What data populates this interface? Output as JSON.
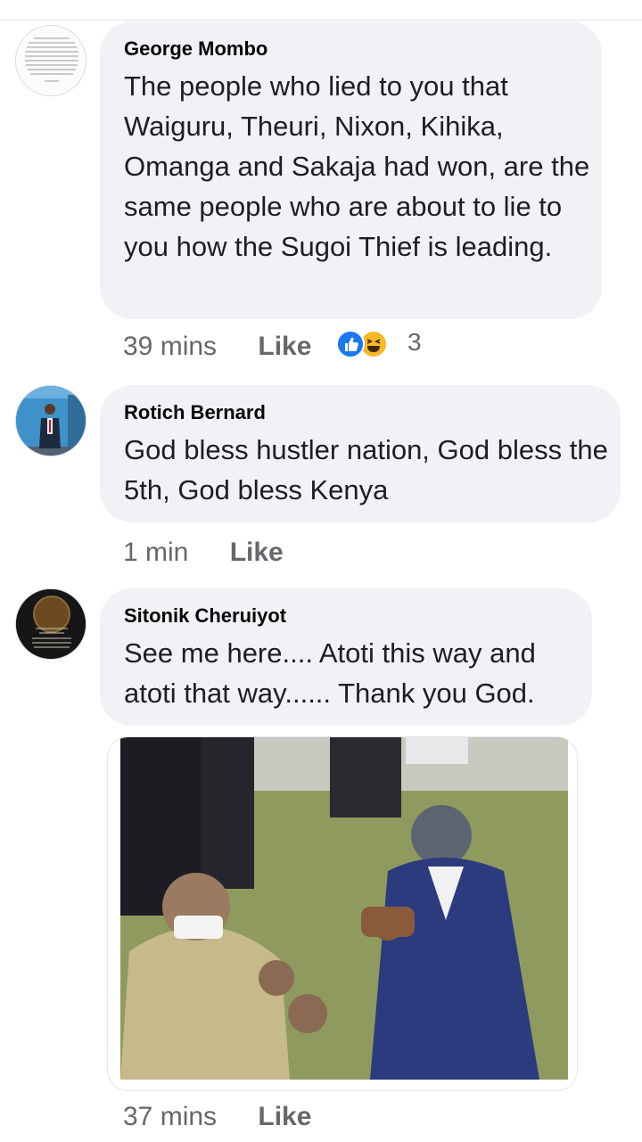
{
  "comments": [
    {
      "author": "George Mombo",
      "text": "The people who lied to you that Waiguru, Theuri, Nixon, Kihika, Omanga and Sakaja had won, are the same people who are about to lie to you how the Sugoi Thief is leading.",
      "time": "39 mins",
      "like_label": "Like",
      "reaction_count": "3",
      "reactions": [
        "like-icon",
        "haha-icon"
      ]
    },
    {
      "author": "Rotich Bernard",
      "text": "God bless hustler nation, God bless the 5th, God bless Kenya",
      "time": "1 min",
      "like_label": "Like"
    },
    {
      "author": "Sitonik Cheruiyot",
      "text": "See me here.... Atoti this way and atoti that way...... Thank you God.",
      "time": "37 mins",
      "like_label": "Like"
    }
  ],
  "colors": {
    "bubble": "#f0f2f5",
    "meta_text": "#65676b",
    "like_blue": "#1877f2",
    "haha_yellow": "#f7b928"
  }
}
